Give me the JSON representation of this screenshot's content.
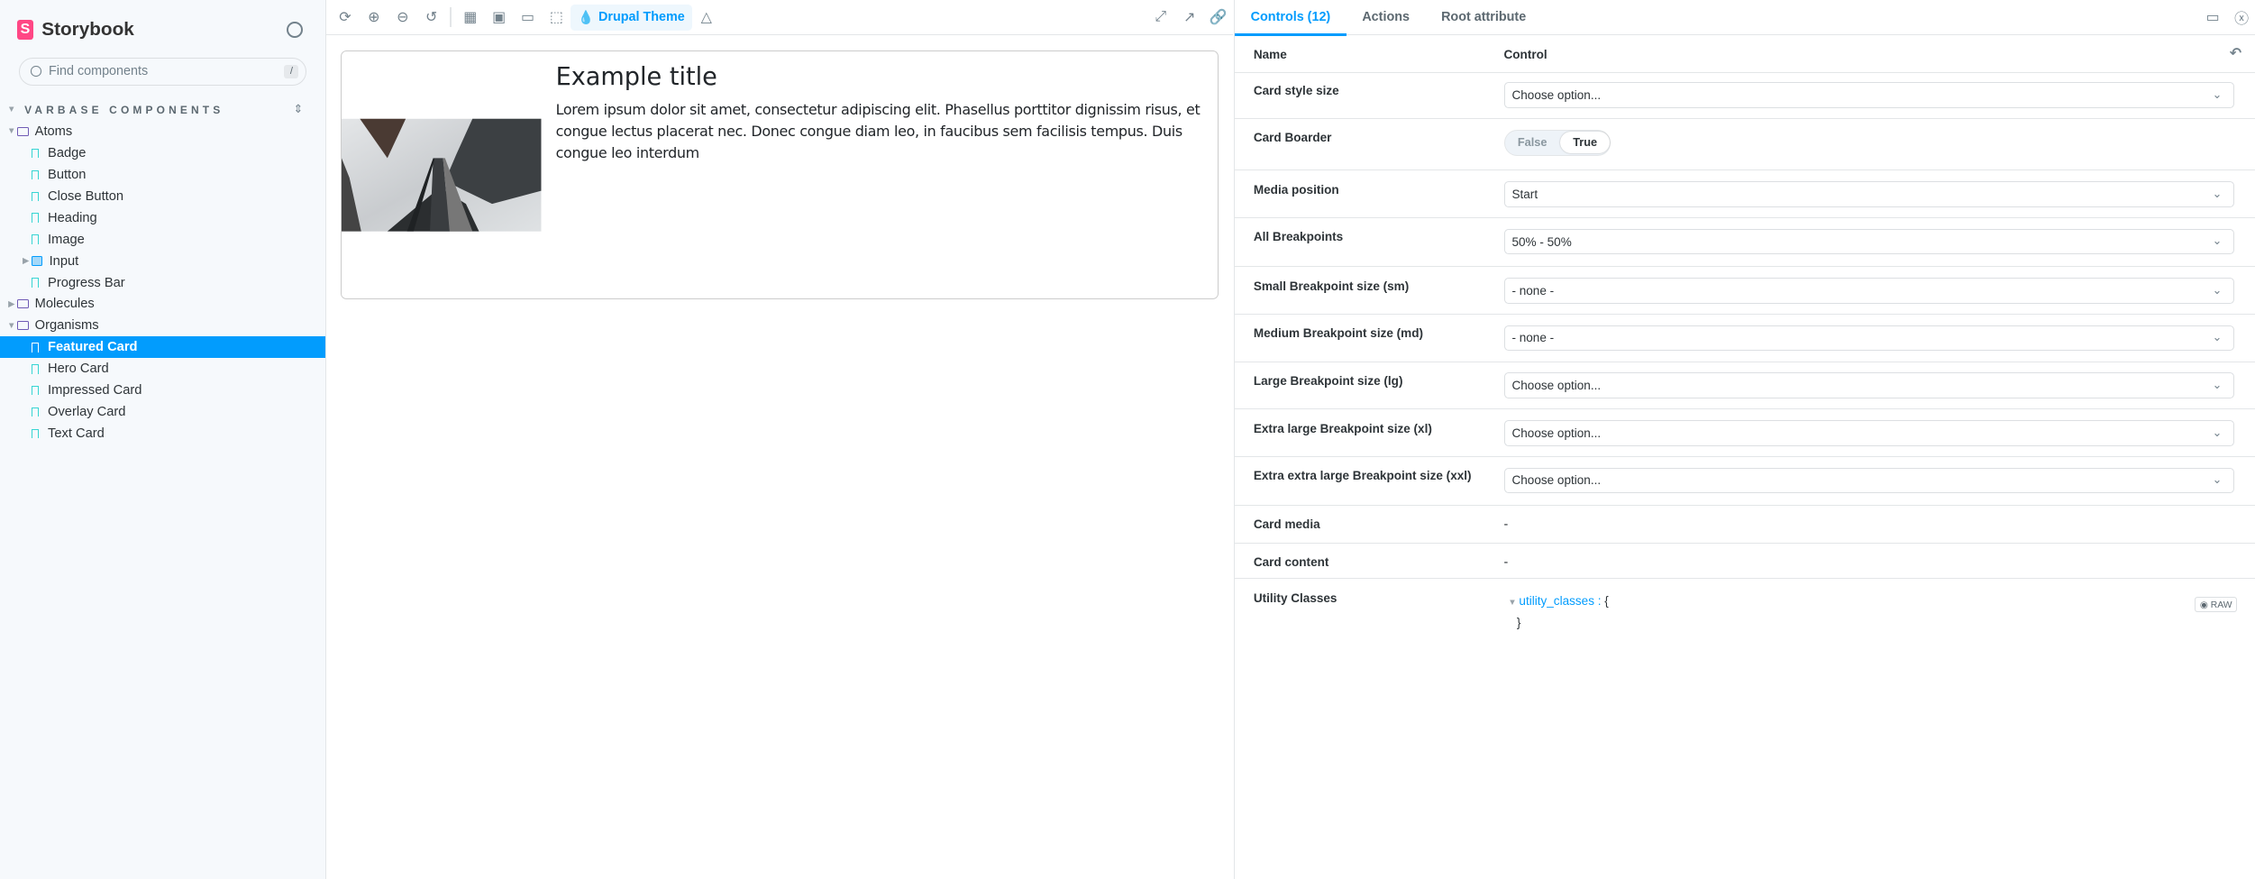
{
  "sidebar": {
    "brand": "Storybook",
    "search_placeholder": "Find components",
    "search_shortcut": "/",
    "section": "VARBASE COMPONENTS",
    "tree": [
      {
        "label": "Atoms",
        "type": "folder",
        "depth": 0,
        "expanded": true
      },
      {
        "label": "Badge",
        "type": "story",
        "depth": 1
      },
      {
        "label": "Button",
        "type": "story",
        "depth": 1
      },
      {
        "label": "Close Button",
        "type": "story",
        "depth": 1
      },
      {
        "label": "Heading",
        "type": "story",
        "depth": 1
      },
      {
        "label": "Image",
        "type": "story",
        "depth": 1
      },
      {
        "label": "Input",
        "type": "component",
        "depth": 1,
        "expanded": false
      },
      {
        "label": "Progress Bar",
        "type": "story",
        "depth": 1
      },
      {
        "label": "Molecules",
        "type": "folder",
        "depth": 0,
        "expanded": false
      },
      {
        "label": "Organisms",
        "type": "folder",
        "depth": 0,
        "expanded": true
      },
      {
        "label": "Featured Card",
        "type": "story",
        "depth": 1,
        "selected": true
      },
      {
        "label": "Hero Card",
        "type": "story",
        "depth": 1
      },
      {
        "label": "Impressed Card",
        "type": "story",
        "depth": 1
      },
      {
        "label": "Overlay Card",
        "type": "story",
        "depth": 1
      },
      {
        "label": "Text Card",
        "type": "story",
        "depth": 1
      }
    ]
  },
  "toolbar": {
    "theme_label": "Drupal Theme"
  },
  "preview": {
    "card_title": "Example title",
    "card_text": "Lorem ipsum dolor sit amet, consectetur adipiscing elit. Phasellus porttitor dignissim risus, et congue lectus placerat nec. Donec congue diam leo, in faucibus sem facilisis tempus. Duis congue leo interdum"
  },
  "panel": {
    "tabs": [
      "Controls (12)",
      "Actions",
      "Root attribute"
    ],
    "header": {
      "name": "Name",
      "control": "Control"
    },
    "rows": [
      {
        "name": "Card style size",
        "kind": "select",
        "value": "Choose option..."
      },
      {
        "name": "Card Boarder",
        "kind": "toggle",
        "off": "False",
        "on": "True"
      },
      {
        "name": "Media position",
        "kind": "select",
        "value": "Start"
      },
      {
        "name": "All Breakpoints",
        "kind": "select",
        "value": "50% - 50%"
      },
      {
        "name": "Small Breakpoint size (sm)",
        "kind": "select",
        "value": "- none -"
      },
      {
        "name": "Medium Breakpoint size (md)",
        "kind": "select",
        "value": "- none -"
      },
      {
        "name": "Large Breakpoint size (lg)",
        "kind": "select",
        "value": "Choose option..."
      },
      {
        "name": "Extra large Breakpoint size (xl)",
        "kind": "select",
        "value": "Choose option..."
      },
      {
        "name": "Extra extra large Breakpoint size (xxl)",
        "kind": "select",
        "value": "Choose option..."
      },
      {
        "name": "Card media",
        "kind": "dash",
        "value": "-"
      },
      {
        "name": "Card content",
        "kind": "dash",
        "value": "-"
      },
      {
        "name": "Utility Classes",
        "kind": "object",
        "key": "utility_classes",
        "open": "{",
        "close": "}",
        "raw_label": "RAW"
      }
    ]
  },
  "colors": {
    "accent": "#029cfd",
    "sidebar_bg": "#f6f9fc"
  }
}
